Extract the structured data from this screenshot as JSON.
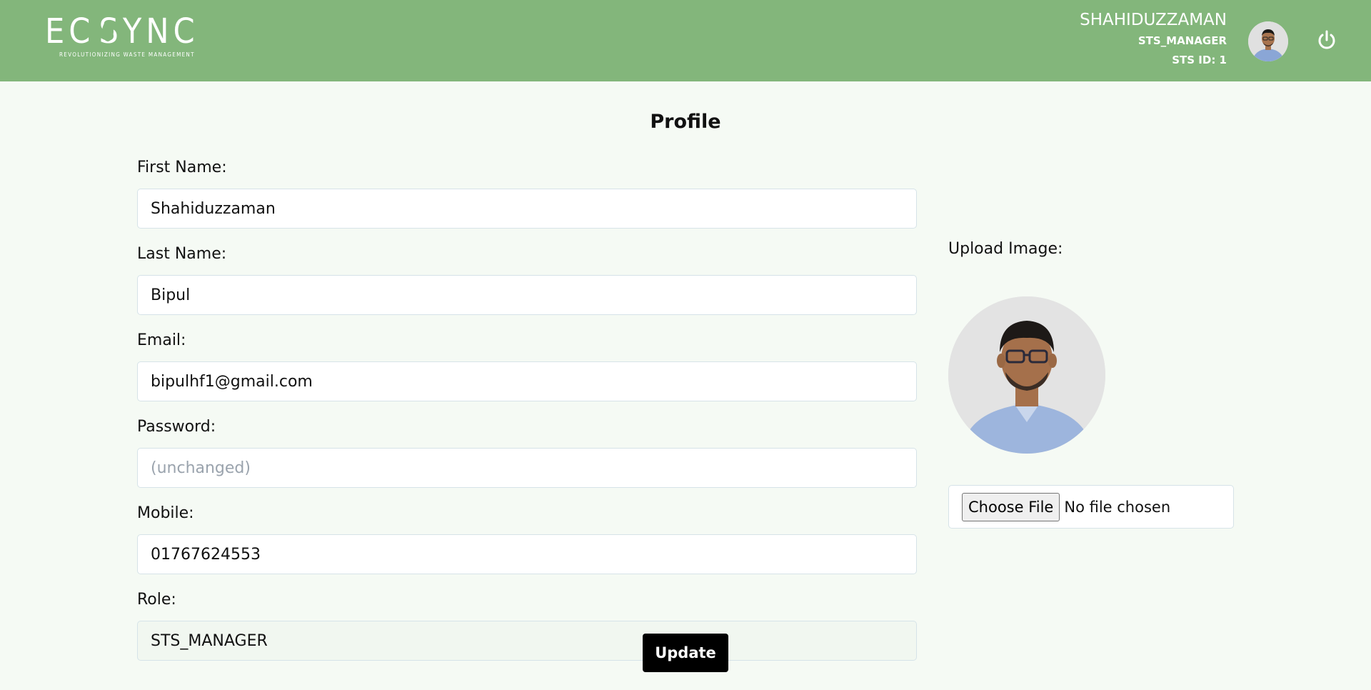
{
  "header": {
    "logo_text_1": "EC",
    "logo_text_2": "SYNC",
    "logo_tagline": "REVOLUTIONIZING WASTE MANAGEMENT",
    "user_name": "SHAHIDUZZAMAN",
    "user_role": "STS_MANAGER",
    "sts_id": "STS ID: 1",
    "power_icon": "power-icon",
    "avatar_icon": "avatar-icon"
  },
  "page": {
    "title": "Profile"
  },
  "form": {
    "first_name": {
      "label": "First Name:",
      "value": "Shahiduzzaman"
    },
    "last_name": {
      "label": "Last Name:",
      "value": "Bipul"
    },
    "email": {
      "label": "Email:",
      "value": "bipulhf1@gmail.com"
    },
    "password": {
      "label": "Password:",
      "value": "",
      "placeholder": "(unchanged)"
    },
    "mobile": {
      "label": "Mobile:",
      "value": "01767624553"
    },
    "role": {
      "label": "Role:",
      "value": "STS_MANAGER"
    }
  },
  "upload": {
    "label": "Upload Image:",
    "choose_button": "Choose File",
    "status": "No file chosen"
  },
  "actions": {
    "update_label": "Update"
  },
  "colors": {
    "header_bg": "#83b67b",
    "page_bg": "#f5faf4",
    "button_bg": "#000000"
  }
}
